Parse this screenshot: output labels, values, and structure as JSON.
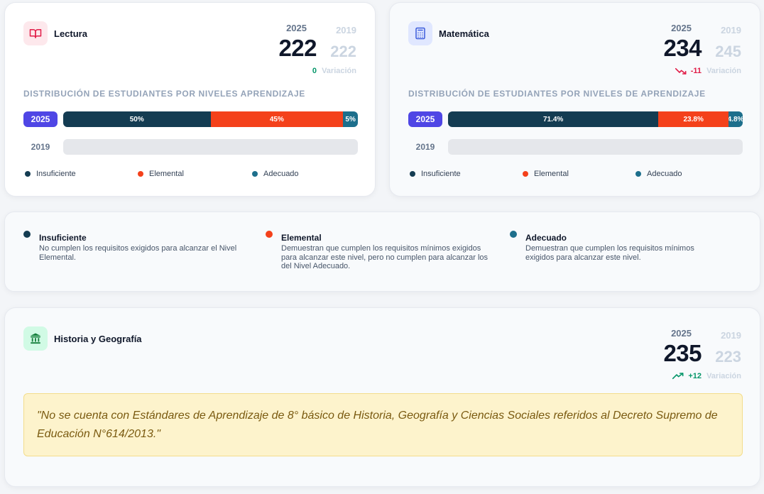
{
  "lectura": {
    "name": "Lectura",
    "icon": "book-icon",
    "year_current": "2025",
    "year_prev": "2019",
    "score_current": "222",
    "score_prev": "222",
    "delta": "0",
    "delta_label": "Variación",
    "dist_title": "Distribución de estudiantes por niveles aprendizaje",
    "bar_2025": [
      {
        "key": "insuficiente",
        "percent": 50,
        "label": "50%"
      },
      {
        "key": "elemental",
        "percent": 45,
        "label": "45%"
      },
      {
        "key": "adecuado",
        "percent": 5,
        "label": "5%"
      }
    ],
    "bar_2019": []
  },
  "matematica": {
    "name": "Matemática",
    "icon": "calculator-icon",
    "year_current": "2025",
    "year_prev": "2019",
    "score_current": "234",
    "score_prev": "245",
    "delta": "-11",
    "delta_label": "Variación",
    "dist_title": "Distribución de estudiantes por niveles de aprendizaje",
    "bar_2025": [
      {
        "key": "insuficiente",
        "percent": 71.4,
        "label": "71.4%"
      },
      {
        "key": "elemental",
        "percent": 23.8,
        "label": "23.8%"
      },
      {
        "key": "adecuado",
        "percent": 4.8,
        "label": "4.8%"
      }
    ],
    "bar_2019": []
  },
  "row_labels": {
    "current": "2025",
    "prev": "2019"
  },
  "legend": {
    "insuficiente": "Insuficiente",
    "elemental": "Elemental",
    "adecuado": "Adecuado"
  },
  "colors": {
    "insuficiente": "#143c52",
    "elemental": "#f4411b",
    "adecuado": "#1d6f8c",
    "year_pill": "#4f46e5",
    "up": "#059669",
    "down": "#e11d48"
  },
  "levels": [
    {
      "key": "insuficiente",
      "title": "Insuficiente",
      "text": "No cumplen los requisitos exigidos para alcanzar el Nivel Elemental."
    },
    {
      "key": "elemental",
      "title": "Elemental",
      "text": "Demuestran que cumplen los requisitos mínimos exigidos para alcanzar este nivel, pero no cumplen para alcanzar los del Nivel Adecuado."
    },
    {
      "key": "adecuado",
      "title": "Adecuado",
      "text": "Demuestran que cumplen los requisitos mínimos exigidos para alcanzar este nivel."
    }
  ],
  "historia": {
    "name": "Historia y Geografía",
    "icon": "landmark-icon",
    "year_current": "2025",
    "year_prev": "2019",
    "score_current": "235",
    "score_prev": "223",
    "delta": "+12",
    "delta_label": "Variación",
    "note": "\"No se cuenta con Estándares de Aprendizaje de 8° básico de Historia, Geografía y Ciencias Sociales referidos al Decreto Supremo de Educación N°614/2013.\""
  }
}
